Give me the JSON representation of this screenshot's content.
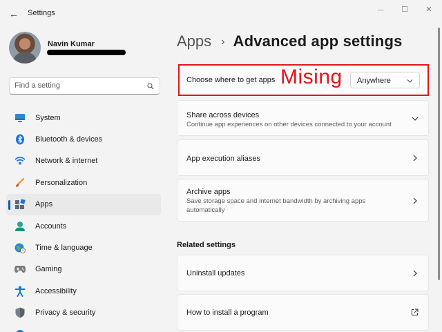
{
  "window": {
    "title": "Settings",
    "back_glyph": "←",
    "min_glyph": "—",
    "max_glyph": "☐",
    "close_glyph": "✕"
  },
  "profile": {
    "name": "Navin Kumar"
  },
  "search": {
    "placeholder": "Find a setting",
    "icon": "search-icon"
  },
  "sidebar": {
    "active_index": 4,
    "items": [
      {
        "label": "System",
        "icon": "system-icon"
      },
      {
        "label": "Bluetooth & devices",
        "icon": "bluetooth-icon"
      },
      {
        "label": "Network & internet",
        "icon": "network-icon"
      },
      {
        "label": "Personalization",
        "icon": "personalization-icon"
      },
      {
        "label": "Apps",
        "icon": "apps-icon"
      },
      {
        "label": "Accounts",
        "icon": "accounts-icon"
      },
      {
        "label": "Time & language",
        "icon": "time-language-icon"
      },
      {
        "label": "Gaming",
        "icon": "gaming-icon"
      },
      {
        "label": "Accessibility",
        "icon": "accessibility-icon"
      },
      {
        "label": "Privacy & security",
        "icon": "privacy-security-icon"
      }
    ]
  },
  "breadcrumb": {
    "parent": "Apps",
    "separator": "›",
    "current": "Advanced app settings"
  },
  "annotation": {
    "text": "Mising",
    "color": "#e4141b"
  },
  "cards": {
    "get_apps": {
      "title": "Choose where to get apps",
      "dropdown_value": "Anywhere"
    },
    "share": {
      "title": "Share across devices",
      "desc": "Continue app experiences on other devices connected to your account"
    },
    "aliases": {
      "title": "App execution aliases"
    },
    "archive": {
      "title": "Archive apps",
      "desc": "Save storage space and internet bandwidth by archiving apps automatically"
    }
  },
  "related": {
    "heading": "Related settings",
    "uninstall": "Uninstall updates",
    "install": "How to install a program"
  },
  "colors": {
    "accent": "#005fb8",
    "annotation_red": "#e4141b"
  }
}
